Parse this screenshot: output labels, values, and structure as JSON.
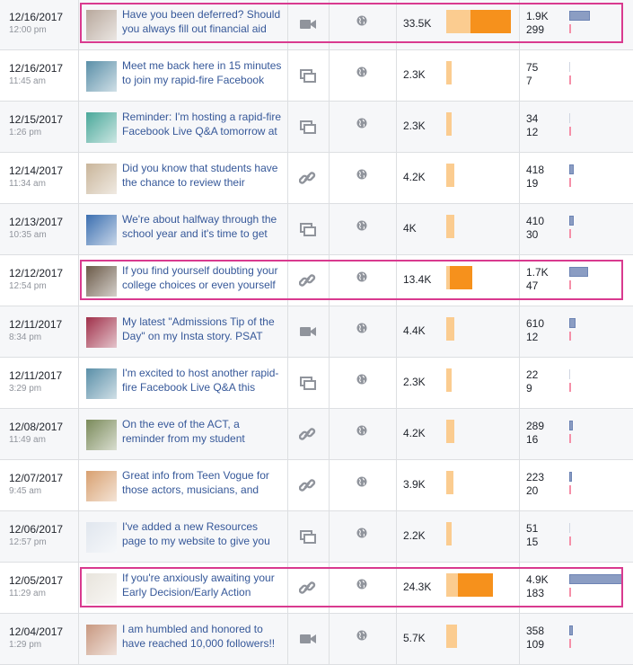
{
  "posts": [
    {
      "date": "12/16/2017",
      "time": "12:00 pm",
      "text": "Have you been deferred? Should you always fill out financial aid",
      "type": "video",
      "reach": "33.5K",
      "reach_value": 33.5,
      "paid_fraction": 0.62,
      "engagement_1": "1.9K",
      "engagement_2": "299",
      "engagement_1_value": 1900,
      "highlighted": true,
      "thumb": "#b8a89c"
    },
    {
      "date": "12/16/2017",
      "time": "11:45 am",
      "text": "Meet me back here in 15 minutes to join my rapid-fire Facebook",
      "type": "status",
      "reach": "2.3K",
      "reach_value": 2.3,
      "paid_fraction": 0,
      "engagement_1": "75",
      "engagement_2": "7",
      "engagement_1_value": 75,
      "highlighted": false,
      "thumb": "#5a8fa8"
    },
    {
      "date": "12/15/2017",
      "time": "1:26 pm",
      "text": "Reminder: I'm hosting a rapid-fire Facebook Live Q&A tomorrow at",
      "type": "status",
      "reach": "2.3K",
      "reach_value": 2.3,
      "paid_fraction": 0,
      "engagement_1": "34",
      "engagement_2": "12",
      "engagement_1_value": 34,
      "highlighted": false,
      "thumb": "#4aa89a"
    },
    {
      "date": "12/14/2017",
      "time": "11:34 am",
      "text": "Did you know that students have the chance to review their",
      "type": "link",
      "reach": "4.2K",
      "reach_value": 4.2,
      "paid_fraction": 0,
      "engagement_1": "418",
      "engagement_2": "19",
      "engagement_1_value": 418,
      "highlighted": false,
      "thumb": "#c9b59a"
    },
    {
      "date": "12/13/2017",
      "time": "10:35 am",
      "text": "We're about halfway through the school year and it's time to get",
      "type": "status",
      "reach": "4K",
      "reach_value": 4.0,
      "paid_fraction": 0,
      "engagement_1": "410",
      "engagement_2": "30",
      "engagement_1_value": 410,
      "highlighted": false,
      "thumb": "#3b6fb0"
    },
    {
      "date": "12/12/2017",
      "time": "12:54 pm",
      "text": "If you find yourself doubting your college choices or even yourself",
      "type": "link",
      "reach": "13.4K",
      "reach_value": 13.4,
      "paid_fraction": 0.85,
      "engagement_1": "1.7K",
      "engagement_2": "47",
      "engagement_1_value": 1700,
      "highlighted": true,
      "thumb": "#6b5a48"
    },
    {
      "date": "12/11/2017",
      "time": "8:34 pm",
      "text": "My latest \"Admissions Tip of the Day\" on my Insta story. PSAT",
      "type": "video",
      "reach": "4.4K",
      "reach_value": 4.4,
      "paid_fraction": 0,
      "engagement_1": "610",
      "engagement_2": "12",
      "engagement_1_value": 610,
      "highlighted": false,
      "thumb": "#a0304a"
    },
    {
      "date": "12/11/2017",
      "time": "3:29 pm",
      "text": "I'm excited to host another rapid-fire Facebook Live Q&A this",
      "type": "status",
      "reach": "2.3K",
      "reach_value": 2.3,
      "paid_fraction": 0,
      "engagement_1": "22",
      "engagement_2": "9",
      "engagement_1_value": 22,
      "highlighted": false,
      "thumb": "#5a8fa8"
    },
    {
      "date": "12/08/2017",
      "time": "11:49 am",
      "text": "On the eve of the ACT, a reminder from my student",
      "type": "link",
      "reach": "4.2K",
      "reach_value": 4.2,
      "paid_fraction": 0,
      "engagement_1": "289",
      "engagement_2": "16",
      "engagement_1_value": 289,
      "highlighted": false,
      "thumb": "#7a8a5a"
    },
    {
      "date": "12/07/2017",
      "time": "9:45 am",
      "text": "Great info from Teen Vogue for those actors, musicians, and",
      "type": "link",
      "reach": "3.9K",
      "reach_value": 3.9,
      "paid_fraction": 0,
      "engagement_1": "223",
      "engagement_2": "20",
      "engagement_1_value": 223,
      "highlighted": false,
      "thumb": "#d8a070"
    },
    {
      "date": "12/06/2017",
      "time": "12:57 pm",
      "text": "I've added a new Resources page to my website to give you",
      "type": "status",
      "reach": "2.2K",
      "reach_value": 2.2,
      "paid_fraction": 0,
      "engagement_1": "51",
      "engagement_2": "15",
      "engagement_1_value": 51,
      "highlighted": false,
      "thumb": "#e0e6ee"
    },
    {
      "date": "12/05/2017",
      "time": "11:29 am",
      "text": "If you're anxiously awaiting your Early Decision/Early Action",
      "type": "link",
      "reach": "24.3K",
      "reach_value": 24.3,
      "paid_fraction": 0.75,
      "engagement_1": "4.9K",
      "engagement_2": "183",
      "engagement_1_value": 4900,
      "highlighted": true,
      "thumb": "#e8e4dc"
    },
    {
      "date": "12/04/2017",
      "time": "1:29 pm",
      "text": "I am humbled and honored to have reached 10,000 followers!!",
      "type": "video",
      "reach": "5.7K",
      "reach_value": 5.7,
      "paid_fraction": 0,
      "engagement_1": "358",
      "engagement_2": "109",
      "engagement_1_value": 358,
      "highlighted": false,
      "thumb": "#c89880"
    }
  ],
  "colors": {
    "organic": "#fbcc90",
    "paid": "#f6911c",
    "engagement": "#8b9dc3",
    "negative": "#f58fa8",
    "highlight": "#d93a8f",
    "link": "#365899"
  }
}
